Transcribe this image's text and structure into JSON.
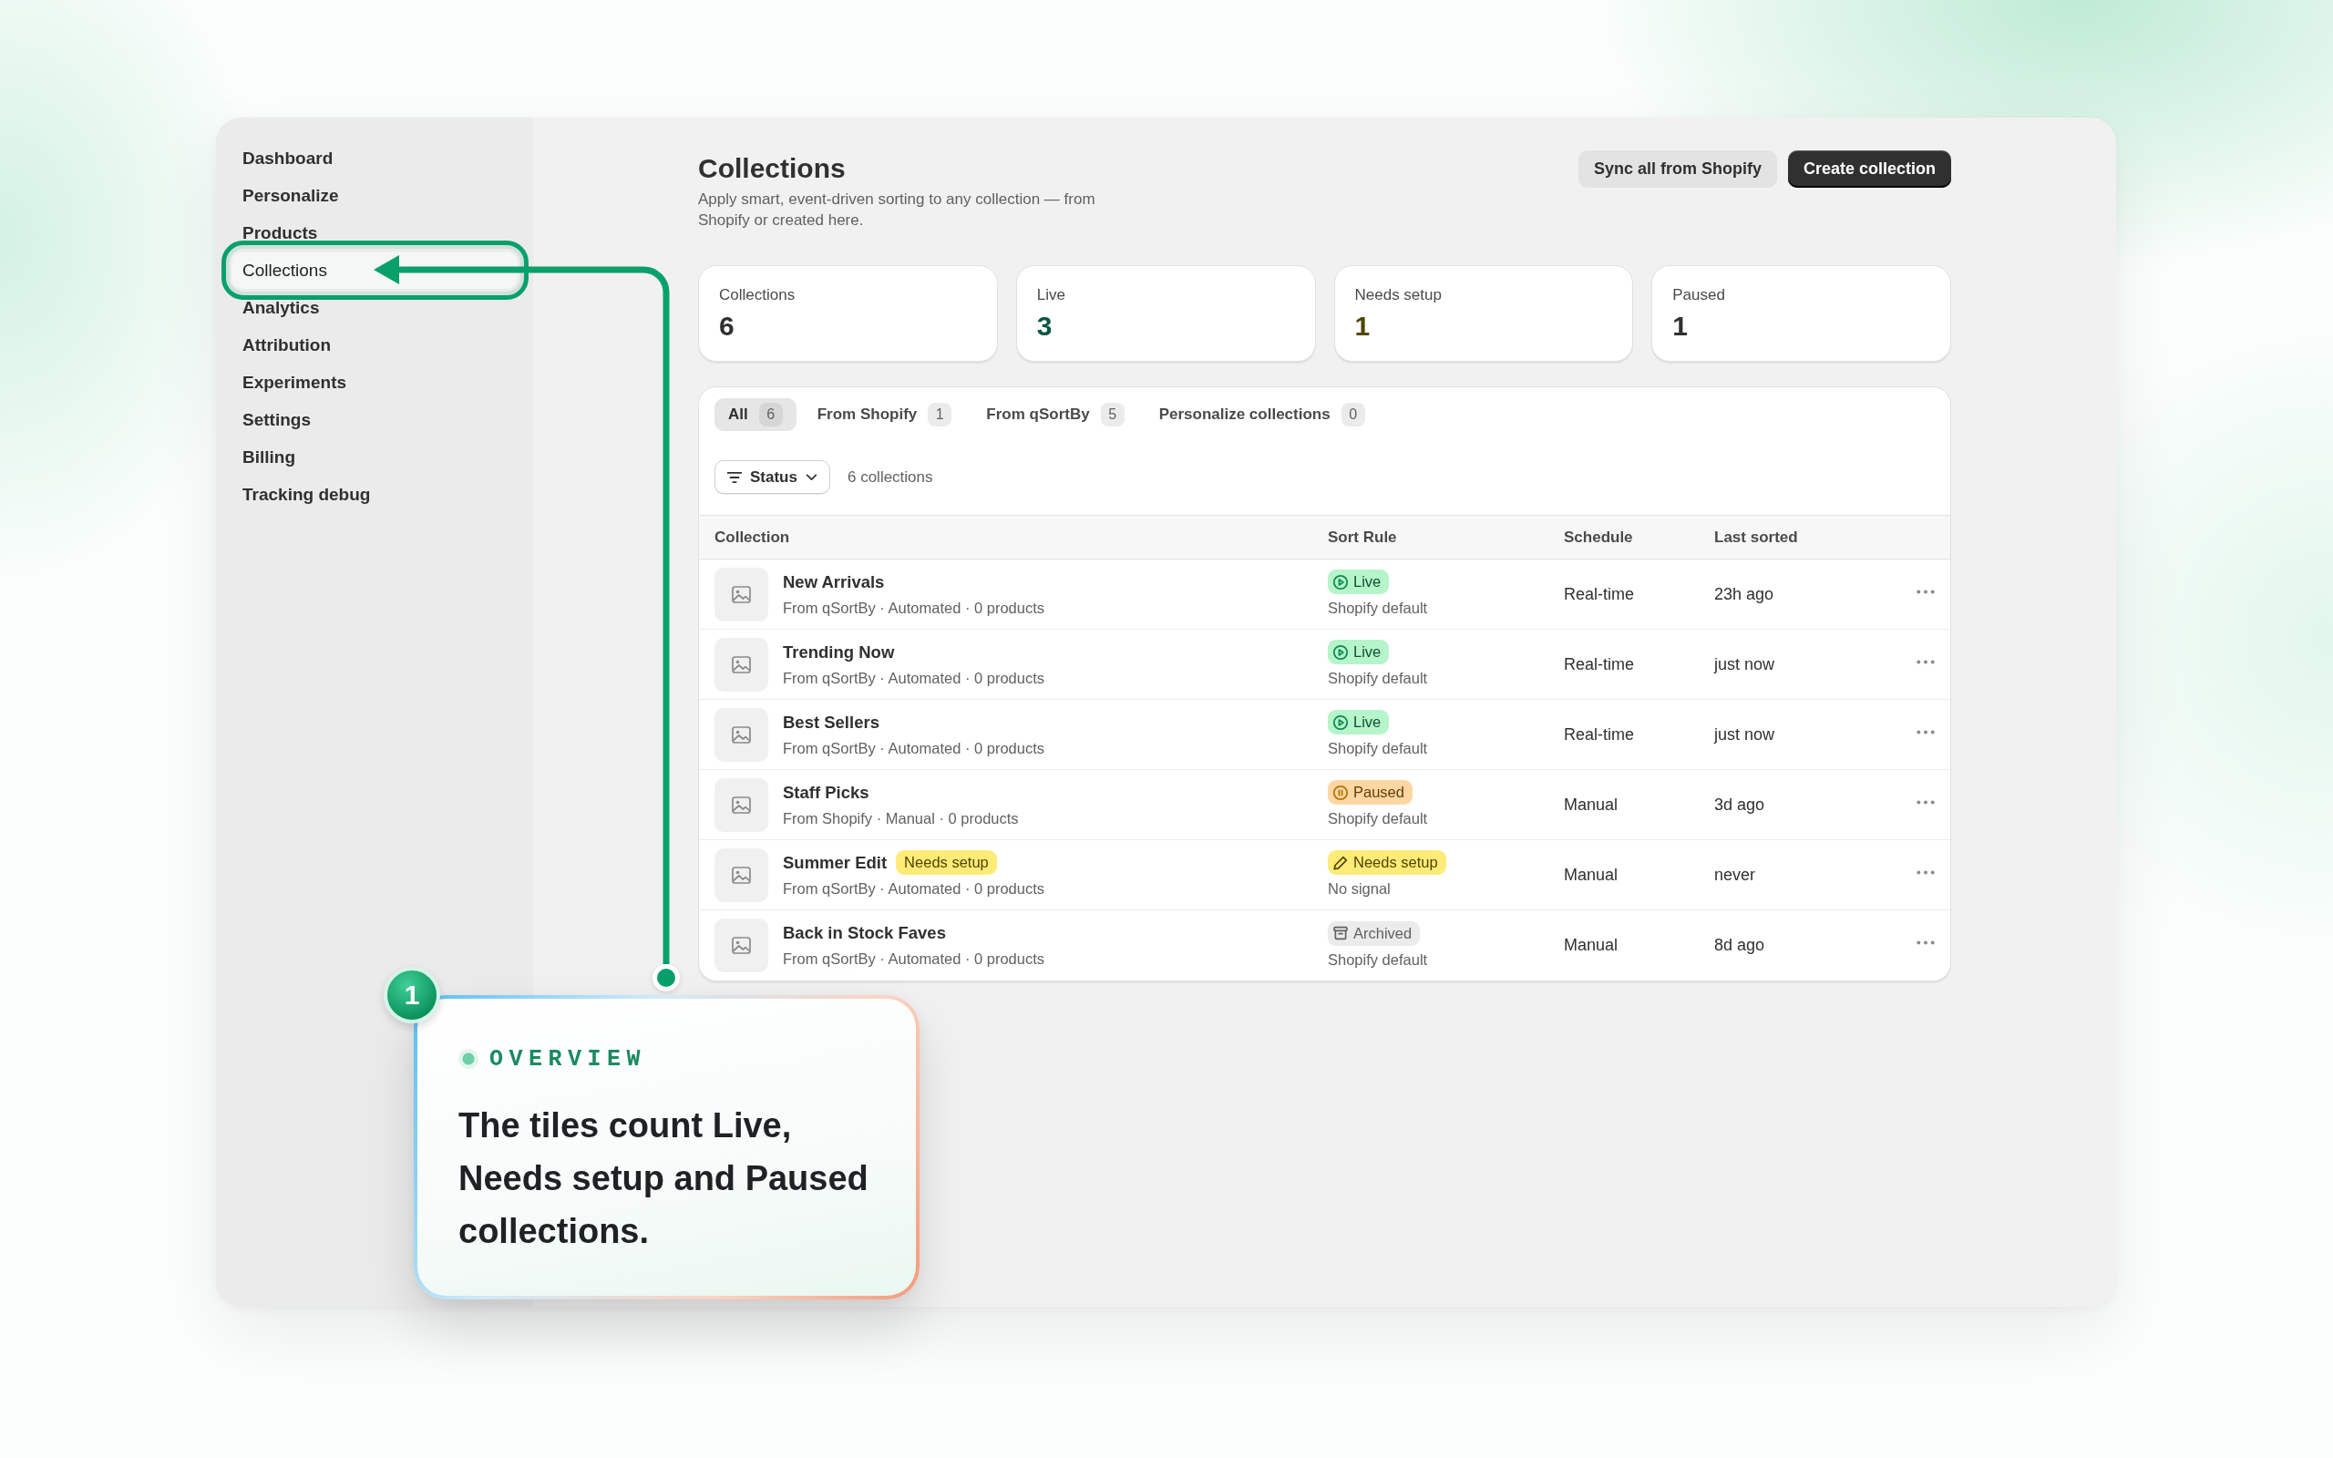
{
  "sidebar": {
    "items": [
      {
        "label": "Dashboard",
        "selected": false
      },
      {
        "label": "Personalize",
        "selected": false
      },
      {
        "label": "Products",
        "selected": false
      },
      {
        "label": "Collections",
        "selected": true
      },
      {
        "label": "Analytics",
        "selected": false
      },
      {
        "label": "Attribution",
        "selected": false
      },
      {
        "label": "Experiments",
        "selected": false
      },
      {
        "label": "Settings",
        "selected": false
      },
      {
        "label": "Billing",
        "selected": false
      },
      {
        "label": "Tracking debug",
        "selected": false
      }
    ]
  },
  "header": {
    "title": "Collections",
    "subtitle": "Apply smart, event-driven sorting to any collection — from Shopify or created here.",
    "buttons": [
      {
        "label": "Sync all from Shopify",
        "kind": "secondary"
      },
      {
        "label": "Create collection",
        "kind": "primary"
      }
    ]
  },
  "stats": [
    {
      "label": "Collections",
      "value": "6",
      "color": "#303030"
    },
    {
      "label": "Live",
      "value": "3",
      "color": "#0d5545"
    },
    {
      "label": "Needs setup",
      "value": "1",
      "color": "#4f4700"
    },
    {
      "label": "Paused",
      "value": "1",
      "color": "#303030"
    }
  ],
  "tabs": [
    {
      "label": "All",
      "count": "6",
      "selected": true
    },
    {
      "label": "From Shopify",
      "count": "1",
      "selected": false
    },
    {
      "label": "From qSortBy",
      "count": "5",
      "selected": false
    },
    {
      "label": "Personalize collections",
      "count": "0",
      "selected": false
    }
  ],
  "filter": {
    "label": "Status",
    "result_count": "6 collections"
  },
  "table": {
    "columns": [
      "Collection",
      "Sort Rule",
      "Schedule",
      "Last sorted"
    ],
    "rows": [
      {
        "name": "New Arrivals",
        "details": "From qSortBy · Automated · 0 products",
        "sort_rule": {
          "kind": "live",
          "label": "Live"
        },
        "sort_source": "Shopify default",
        "schedule": "Real-time",
        "last_sorted": "23h ago"
      },
      {
        "name": "Trending Now",
        "details": "From qSortBy · Automated · 0 products",
        "sort_rule": {
          "kind": "live",
          "label": "Live"
        },
        "sort_source": "Shopify default",
        "schedule": "Real-time",
        "last_sorted": "just now"
      },
      {
        "name": "Best Sellers",
        "details": "From qSortBy · Automated · 0 products",
        "sort_rule": {
          "kind": "live",
          "label": "Live"
        },
        "sort_source": "Shopify default",
        "schedule": "Real-time",
        "last_sorted": "just now"
      },
      {
        "name": "Staff Picks",
        "details": "From Shopify · Manual · 0 products",
        "sort_rule": {
          "kind": "paused",
          "label": "Paused"
        },
        "sort_source": "Shopify default",
        "schedule": "Manual",
        "last_sorted": "3d ago"
      },
      {
        "name": "Summer Edit",
        "tag": {
          "kind": "needs_setup",
          "label": "Needs setup"
        },
        "details": "From qSortBy · Automated · 0 products",
        "sort_rule": {
          "kind": "needs_setup",
          "label": "Needs setup"
        },
        "sort_source": "No signal",
        "schedule": "Manual",
        "last_sorted": "never"
      },
      {
        "name": "Back in Stock Faves",
        "details": "From qSortBy · Automated · 0 products",
        "sort_rule": {
          "kind": "archived",
          "label": "Archived"
        },
        "sort_source": "Shopify default",
        "schedule": "Manual",
        "last_sorted": "8d ago"
      }
    ]
  },
  "callout": {
    "step": "1",
    "eyebrow": "OVERVIEW",
    "text": "The tiles count Live, Needs setup and Paused collections."
  }
}
